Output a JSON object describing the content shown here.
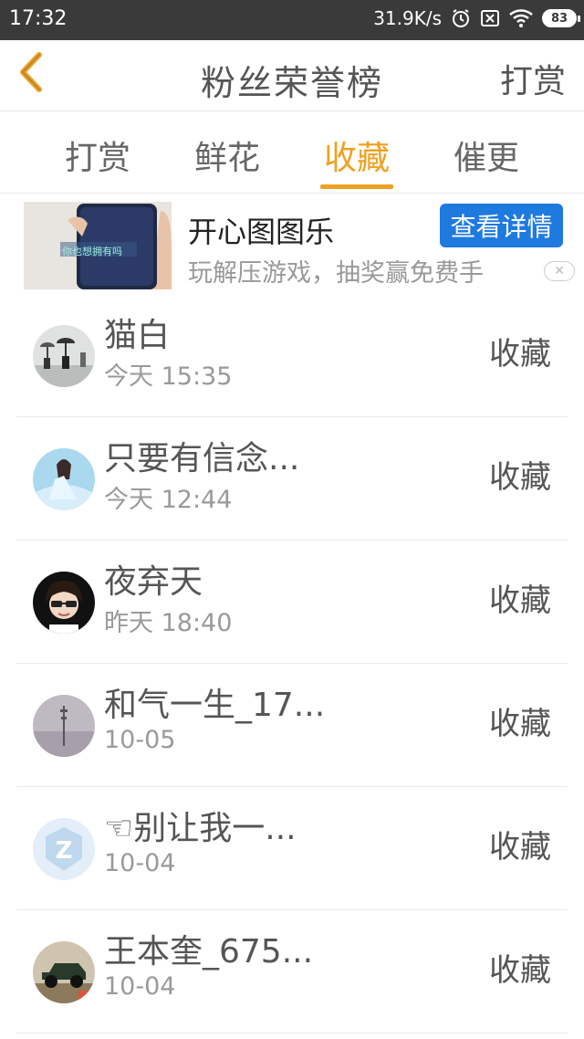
{
  "status_bar": {
    "time": "17:32",
    "network_speed": "31.9K/s",
    "battery": "83",
    "icons": [
      "alarm-icon",
      "sim-off-icon",
      "wifi-icon",
      "battery-icon"
    ]
  },
  "nav": {
    "title": "粉丝荣誉榜",
    "right_action": "打赏"
  },
  "tabs": [
    {
      "label": "打赏"
    },
    {
      "label": "鲜花"
    },
    {
      "label": "收藏"
    },
    {
      "label": "催更"
    }
  ],
  "active_tab": "收藏",
  "accent_color": "#f0a020",
  "ad": {
    "title": "开心图图乐",
    "description": "玩解压游戏，抽奖赢免费手",
    "button_label": "查看详情",
    "thumb_text": "你也想拥有吗"
  },
  "fans": [
    {
      "name": "猫白",
      "time": "今天 15:35",
      "action": "收藏"
    },
    {
      "name": "只要有信念...",
      "time": "今天 12:44",
      "action": "收藏"
    },
    {
      "name": "夜弃天",
      "time": "昨天 18:40",
      "action": "收藏"
    },
    {
      "name": "和气一生_17...",
      "time": "10-05",
      "action": "收藏"
    },
    {
      "name": "☜别让我一...",
      "time": "10-04",
      "action": "收藏"
    },
    {
      "name": "王本奎_675...",
      "time": "10-04",
      "action": "收藏"
    }
  ]
}
